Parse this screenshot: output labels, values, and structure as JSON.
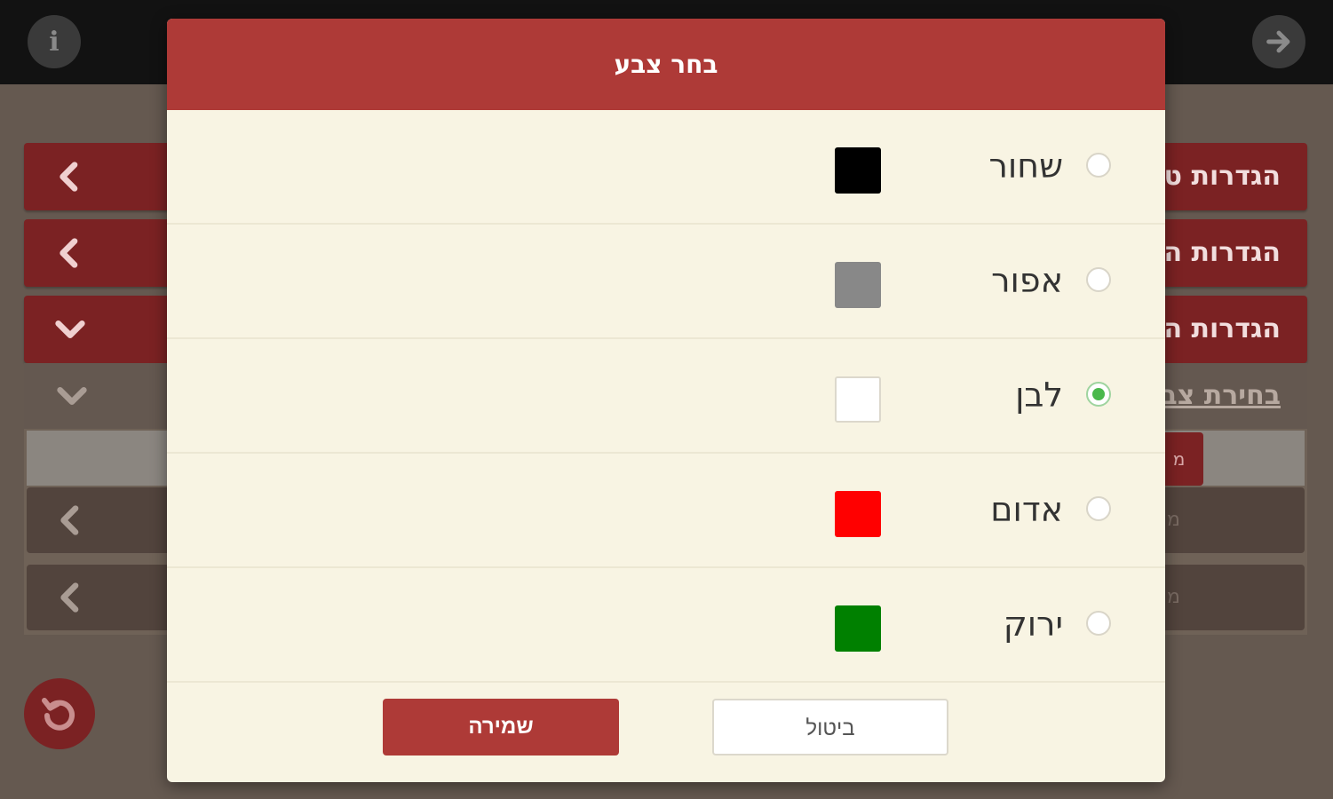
{
  "background": {
    "info_icon": "i",
    "rows": [
      {
        "label": "הגדרות ט"
      },
      {
        "label": "הגדרות ה"
      },
      {
        "label": "הגדרות ה"
      }
    ],
    "sub_header_label": "בחירת צב",
    "sub_tag": "מ",
    "sub_rows": [
      {
        "mini": "מ"
      },
      {
        "mini": "מ"
      }
    ]
  },
  "dialog": {
    "title": "בחר צבע",
    "options": [
      {
        "label": "שחור",
        "color": "#000000",
        "selected": false
      },
      {
        "label": "אפור",
        "color": "#888888",
        "selected": false
      },
      {
        "label": "לבן",
        "color": "#ffffff",
        "selected": true
      },
      {
        "label": "אדום",
        "color": "#ff0000",
        "selected": false
      },
      {
        "label": "ירוק",
        "color": "#008000",
        "selected": false
      }
    ],
    "save_label": "שמירה",
    "cancel_label": "ביטול"
  },
  "colors": {
    "accent": "#ae3a37",
    "radio_selected": "#4ab84c"
  }
}
